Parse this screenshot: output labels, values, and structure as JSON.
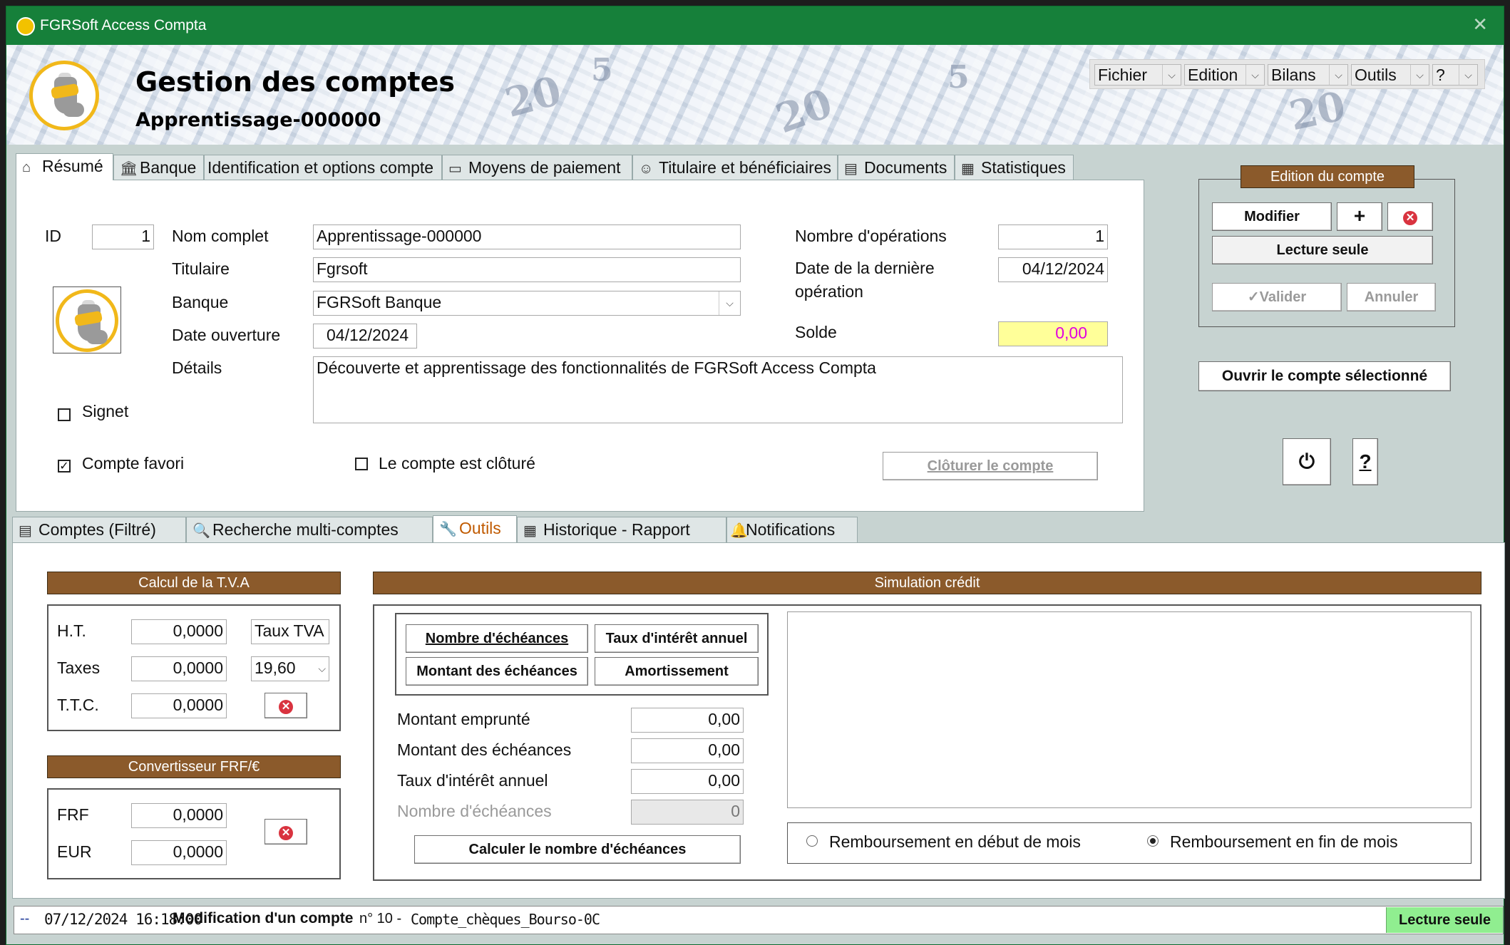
{
  "window": {
    "title": "FGRSoft Access Compta"
  },
  "header": {
    "title": "Gestion des comptes",
    "subtitle": "Apprentissage-000000",
    "menus": [
      "Fichier",
      "Edition",
      "Bilans",
      "Outils",
      "?"
    ]
  },
  "top_tabs": [
    {
      "label": "Résumé",
      "icon": "home-icon"
    },
    {
      "label": "Banque",
      "icon": "bank-icon"
    },
    {
      "label": "Identification et options compte",
      "icon": ""
    },
    {
      "label": "Moyens de paiement",
      "icon": "card-icon"
    },
    {
      "label": "Titulaire et bénéficiaires",
      "icon": "person-icon"
    },
    {
      "label": "Documents",
      "icon": "document-icon"
    },
    {
      "label": "Statistiques",
      "icon": "stats-icon"
    }
  ],
  "resume": {
    "id_label": "ID",
    "id_value": "1",
    "nom_label": "Nom complet",
    "nom_value": "Apprentissage-000000",
    "titulaire_label": "Titulaire",
    "titulaire_value": "Fgrsoft",
    "banque_label": "Banque",
    "banque_value": "FGRSoft Banque",
    "date_label": "Date ouverture",
    "date_value": "04/12/2024",
    "details_label": "Détails",
    "details_value": "Découverte et apprentissage des fonctionnalités de FGRSoft Access Compta",
    "signet_label": "Signet",
    "signet_checked": false,
    "favori_label": "Compte favori",
    "favori_checked": true,
    "cloture_label": "Le compte est clôturé",
    "cloture_checked": false,
    "nb_ops_label": "Nombre d'opérations",
    "nb_ops_value": "1",
    "derniere_label_1": "Date de la dernière",
    "derniere_label_2": "opération",
    "derniere_value": "04/12/2024",
    "solde_label": "Solde",
    "solde_value": "0,00",
    "cloturer_button": "Clôturer le compte"
  },
  "edition": {
    "title": "Edition du compte",
    "modifier": "Modifier",
    "plus": "+",
    "lecture_seule": "Lecture seule",
    "valider": "Valider",
    "annuler": "Annuler",
    "ouvrir": "Ouvrir le compte sélectionné",
    "help": "?"
  },
  "bottom_tabs": [
    {
      "label": "Comptes (Filtré)",
      "icon": "list-icon"
    },
    {
      "label": "Recherche multi-comptes",
      "icon": "search-icon"
    },
    {
      "label": "Outils",
      "icon": "wrench-icon"
    },
    {
      "label": "Historique - Rapport",
      "icon": "calendar-icon"
    },
    {
      "label": "Notifications",
      "icon": "bell-icon"
    }
  ],
  "tva": {
    "title": "Calcul de la T.V.A",
    "ht_label": "H.T.",
    "ht_value": "0,0000",
    "taxes_label": "Taxes",
    "taxes_value": "0,0000",
    "ttc_label": "T.T.C.",
    "ttc_value": "0,0000",
    "taux_label": "Taux TVA",
    "taux_value": "19,60"
  },
  "converter": {
    "title": "Convertisseur FRF/€",
    "frf_label": "FRF",
    "frf_value": "0,0000",
    "eur_label": "EUR",
    "eur_value": "0,0000"
  },
  "credit": {
    "title": "Simulation crédit",
    "btn_nb": "Nombre d'échéances",
    "btn_taux": "Taux d'intérêt annuel",
    "btn_montant": "Montant des échéances",
    "btn_amort": "Amortissement",
    "emprunte_label": "Montant emprunté",
    "emprunte_value": "0,00",
    "echeances_label": "Montant des échéances",
    "echeances_value": "0,00",
    "taux_label": "Taux d'intérêt annuel",
    "taux_value": "0,00",
    "nb_label": "Nombre d'échéances",
    "nb_value": "0",
    "calc_button": "Calculer le nombre d'échéances",
    "radio_debut": "Remboursement en début de mois",
    "radio_fin": "Remboursement en fin de mois",
    "radio_selected": "fin"
  },
  "status": {
    "prefix": "--",
    "datetime": "07/12/2024 16:18:00",
    "action": "Modification d'un compte",
    "detail": "n° 10 -",
    "account": "Compte_chèques_Bourso-0C",
    "mode": "Lecture seule"
  },
  "colors": {
    "titlebar": "#16803a",
    "section_header": "#8b5a2b",
    "menu_text": "#c05a00",
    "solde_bg": "#ffff99",
    "solde_text": "#e000e0",
    "status_mode_bg": "#90ee90"
  }
}
